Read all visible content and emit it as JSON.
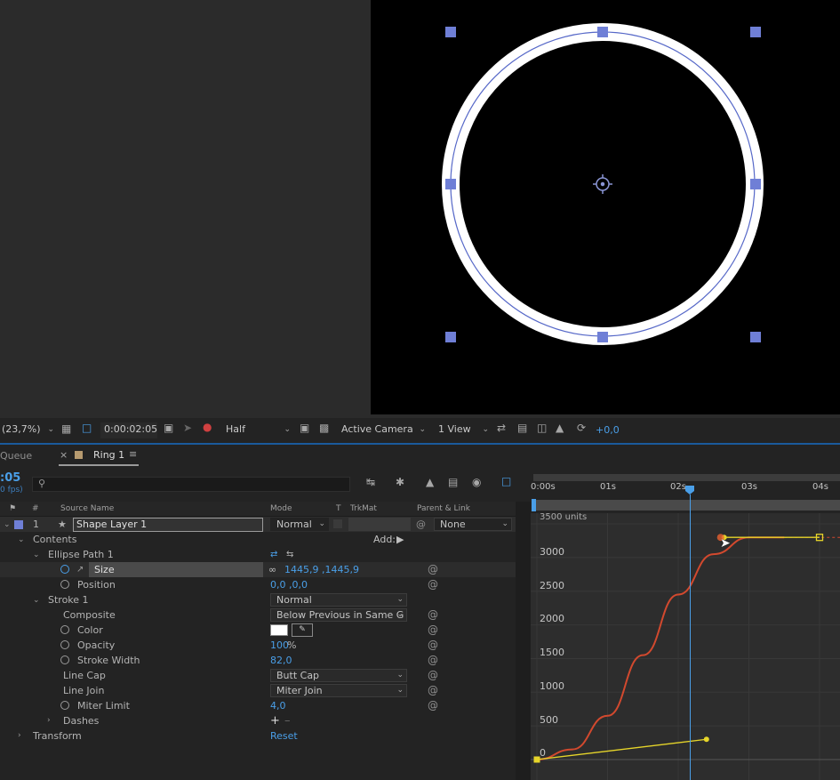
{
  "viewer": {
    "zoom": "(23,7%)",
    "timecode": "0:00:02:05",
    "resolution": "Half",
    "camera": "Active Camera",
    "view": "1 View",
    "exposure": "+0,0"
  },
  "tabs": {
    "queue": "Queue",
    "comp": "Ring 1"
  },
  "timeline": {
    "time": ":05",
    "fps": "0 fps)",
    "search_placeholder": "",
    "col_hash": "#",
    "col_source": "Source Name",
    "col_mode": "Mode",
    "col_t": "T",
    "col_trkmat": "TrkMat",
    "col_parent": "Parent & Link",
    "layer": {
      "num": "1",
      "name": "Shape Layer 1",
      "mode": "Normal",
      "parent": "None"
    },
    "add_label": "Add:",
    "props": {
      "contents": "Contents",
      "ellipse": "Ellipse Path 1",
      "size_label": "Size",
      "size_value": "1445,9 ,1445,9",
      "position_label": "Position",
      "position_value": "0,0 ,0,0",
      "stroke": "Stroke 1",
      "stroke_mode": "Normal",
      "composite_label": "Composite",
      "composite_value": "Below Previous in Same G",
      "color_label": "Color",
      "opacity_label": "Opacity",
      "opacity_value": "100",
      "opacity_unit": "%",
      "stroke_width_label": "Stroke Width",
      "stroke_width_value": "82,0",
      "line_cap_label": "Line Cap",
      "line_cap_value": "Butt Cap",
      "line_join_label": "Line Join",
      "line_join_value": "Miter Join",
      "miter_label": "Miter Limit",
      "miter_value": "4,0",
      "dashes": "Dashes",
      "transform": "Transform",
      "reset": "Reset"
    }
  },
  "ruler": {
    "ticks": [
      "0:00s",
      "01s",
      "02s",
      "03s",
      "04s"
    ]
  },
  "graph": {
    "units_label": "3500 units",
    "y_labels": [
      "3000",
      "2500",
      "2000",
      "1500",
      "1000",
      "500",
      "0"
    ]
  },
  "colors": {
    "accent": "#4a9fe8",
    "handle": "#6f7fd6",
    "curve": "#d2492e",
    "bezier": "#e6d52a"
  },
  "chart_data": {
    "type": "line",
    "title": "",
    "xlabel": "",
    "ylabel": "",
    "x": [
      0.0,
      0.5,
      1.0,
      1.5,
      2.0,
      2.5,
      3.0,
      3.5
    ],
    "series": [
      {
        "values": [
          0,
          150,
          650,
          1550,
          2450,
          3050,
          3300,
          3300
        ]
      }
    ],
    "ylim": [
      0,
      3500
    ],
    "xlim": [
      0,
      4.2
    ]
  }
}
